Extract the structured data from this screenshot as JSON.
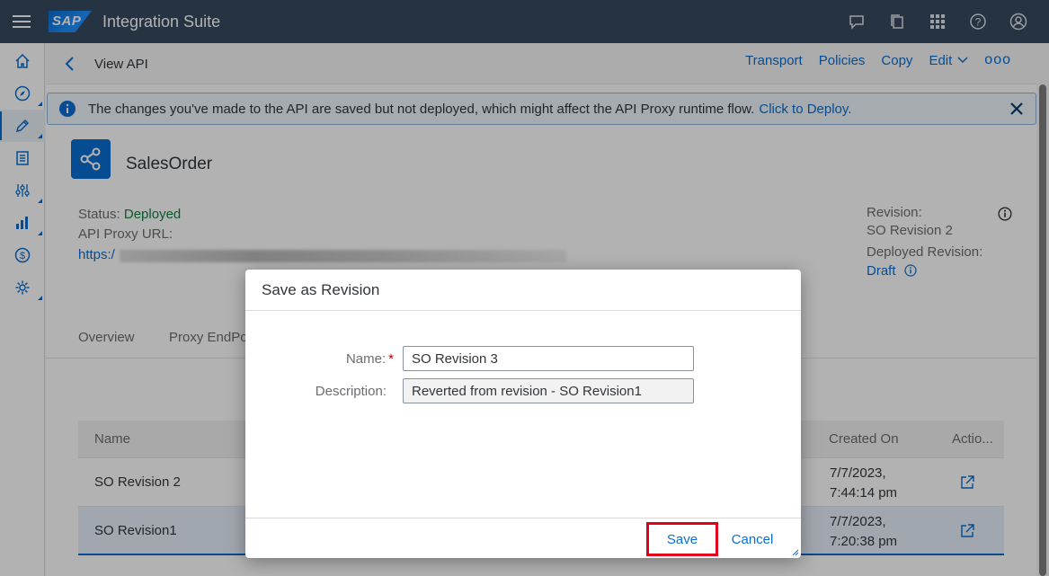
{
  "shell": {
    "logo": "SAP",
    "title": "Integration Suite"
  },
  "subheader": {
    "title": "View API",
    "links": {
      "transport": "Transport",
      "policies": "Policies",
      "copy": "Copy",
      "edit": "Edit",
      "more": "ooo"
    }
  },
  "message": {
    "text": "The changes you've made to the API are saved but not deployed, which might affect the API Proxy runtime flow.",
    "link": "Click to Deploy."
  },
  "api": {
    "name": "SalesOrder",
    "status_label": "Status:",
    "status_value": "Deployed",
    "proxy_url_label": "API Proxy URL:",
    "proxy_url_prefix": "https:/",
    "revision_label": "Revision:",
    "revision_value": "SO Revision 2",
    "deployed_revision_label": "Deployed Revision:",
    "deployed_revision_value": "Draft"
  },
  "tabs": [
    "Overview",
    "Proxy EndPo"
  ],
  "table": {
    "headers": {
      "name": "Name",
      "created_on": "Created On",
      "actions": "Actio..."
    },
    "rows": [
      {
        "name": "SO Revision 2",
        "date": "7/7/2023,",
        "time": "7:44:14 pm"
      },
      {
        "name": "SO Revision1",
        "date": "7/7/2023,",
        "time": "7:20:38 pm"
      }
    ]
  },
  "dialog": {
    "title": "Save as Revision",
    "name_label": "Name:",
    "name_required": "*",
    "name_value": "SO Revision 3",
    "description_label": "Description:",
    "description_value": "Reverted from revision - SO Revision1",
    "save": "Save",
    "cancel": "Cancel"
  },
  "colors": {
    "shell": "#354a5f",
    "accent": "#0a6ed1",
    "positive": "#107e3e",
    "highlight": "#e0001b"
  }
}
